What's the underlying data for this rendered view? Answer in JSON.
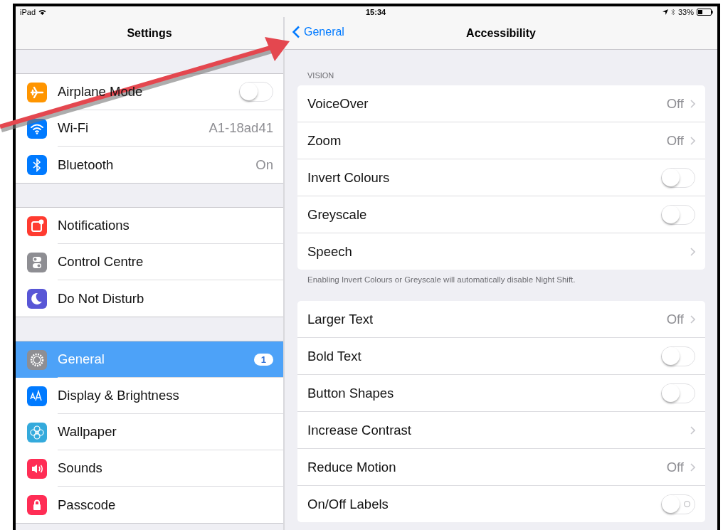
{
  "status_bar": {
    "device": "iPad",
    "time": "15:34",
    "battery": "33%"
  },
  "sidebar": {
    "title": "Settings",
    "sections": [
      {
        "items": [
          {
            "label": "Airplane Mode",
            "kind": "toggle",
            "on": false,
            "selected": false,
            "color": "#ff9500"
          },
          {
            "label": "Wi-Fi",
            "kind": "value",
            "value": "A1-18ad41",
            "selected": false,
            "color": "#007aff"
          },
          {
            "label": "Bluetooth",
            "kind": "value",
            "value": "On",
            "selected": false,
            "color": "#007aff"
          }
        ]
      },
      {
        "items": [
          {
            "label": "Notifications",
            "kind": "plain",
            "selected": false,
            "color": "#ff3b30"
          },
          {
            "label": "Control Centre",
            "kind": "plain",
            "selected": false,
            "color": "#8e8e93"
          },
          {
            "label": "Do Not Disturb",
            "kind": "plain",
            "selected": false,
            "color": "#5856d6"
          }
        ]
      },
      {
        "items": [
          {
            "label": "General",
            "kind": "badge",
            "badge": "1",
            "selected": true,
            "color": "#8e8e93"
          },
          {
            "label": "Display & Brightness",
            "kind": "plain",
            "selected": false,
            "color": "#007aff"
          },
          {
            "label": "Wallpaper",
            "kind": "plain",
            "selected": false,
            "color": "#34aadc"
          },
          {
            "label": "Sounds",
            "kind": "plain",
            "selected": false,
            "color": "#ff2d55"
          },
          {
            "label": "Passcode",
            "kind": "plain",
            "selected": false,
            "color": "#ff2d55"
          }
        ]
      }
    ]
  },
  "detail": {
    "back": "General",
    "title": "Accessibility",
    "groups": [
      {
        "header": "VISION",
        "rows": [
          {
            "label": "VoiceOver",
            "kind": "chevron",
            "value": "Off"
          },
          {
            "label": "Zoom",
            "kind": "chevron",
            "value": "Off"
          },
          {
            "label": "Invert Colours",
            "kind": "toggle",
            "on": false
          },
          {
            "label": "Greyscale",
            "kind": "toggle",
            "on": false
          },
          {
            "label": "Speech",
            "kind": "chevron"
          }
        ],
        "footer": "Enabling Invert Colours or Greyscale will automatically disable Night Shift."
      },
      {
        "rows": [
          {
            "label": "Larger Text",
            "kind": "chevron",
            "value": "Off"
          },
          {
            "label": "Bold Text",
            "kind": "toggle",
            "on": false
          },
          {
            "label": "Button Shapes",
            "kind": "toggle",
            "on": false
          },
          {
            "label": "Increase Contrast",
            "kind": "chevron"
          },
          {
            "label": "Reduce Motion",
            "kind": "chevron",
            "value": "Off"
          },
          {
            "label": "On/Off Labels",
            "kind": "toggle",
            "on": false,
            "off_mark": true
          }
        ]
      }
    ]
  }
}
